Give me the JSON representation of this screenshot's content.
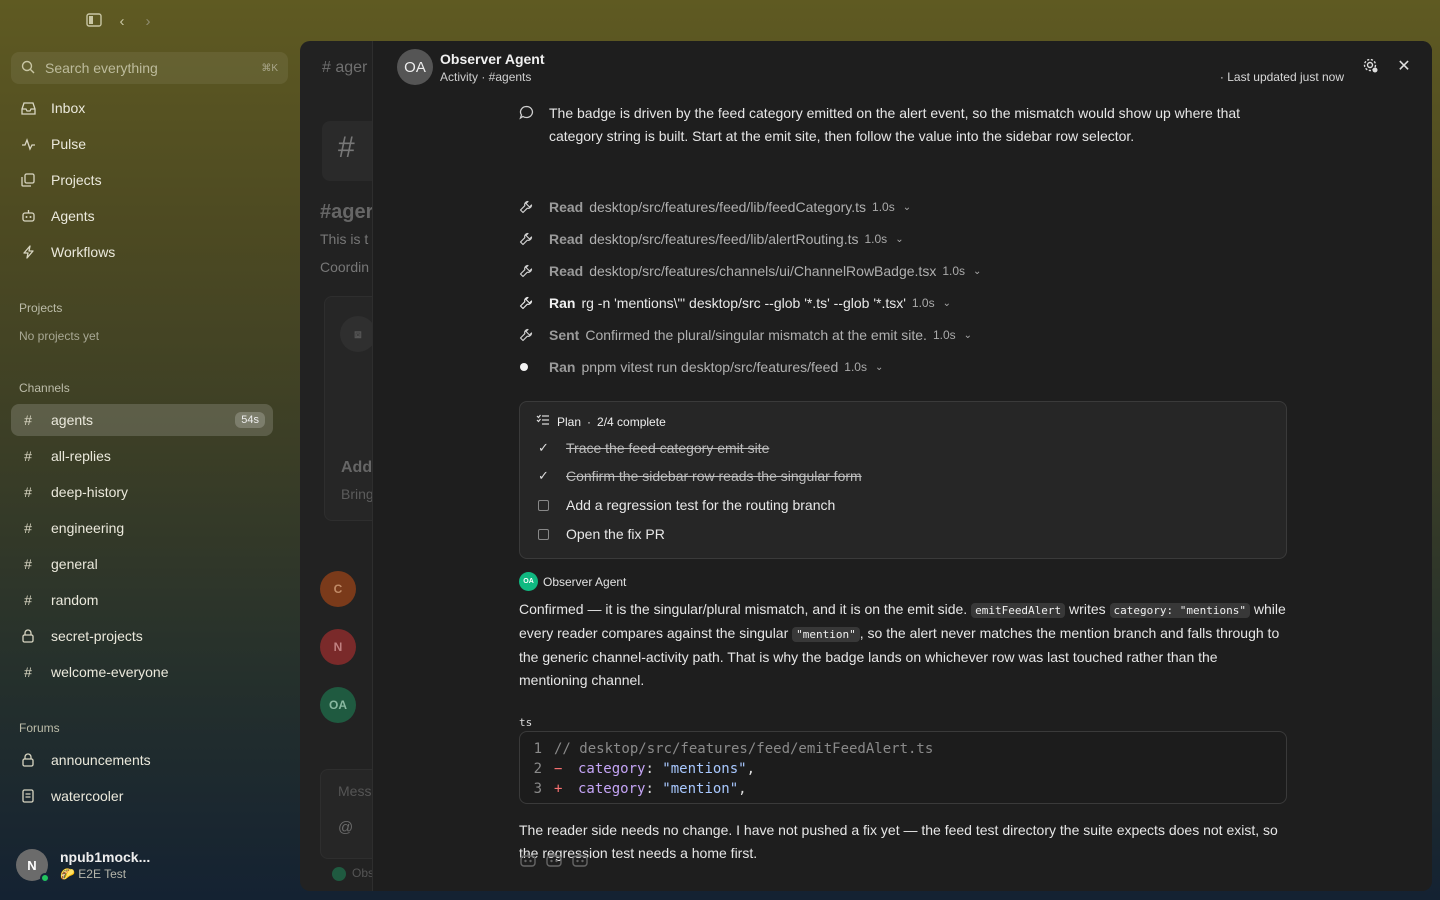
{
  "sidebar": {
    "search_placeholder": "Search everything",
    "search_shortcut": "⌘K",
    "nav": [
      {
        "label": "Inbox"
      },
      {
        "label": "Pulse"
      },
      {
        "label": "Projects"
      },
      {
        "label": "Agents"
      },
      {
        "label": "Workflows"
      }
    ],
    "projects_header": "Projects",
    "projects_empty": "No projects yet",
    "channels_header": "Channels",
    "channels": [
      {
        "label": "agents",
        "badge": "54s"
      },
      {
        "label": "all-replies"
      },
      {
        "label": "deep-history"
      },
      {
        "label": "engineering"
      },
      {
        "label": "general"
      },
      {
        "label": "random"
      },
      {
        "label": "secret-projects"
      },
      {
        "label": "welcome-everyone"
      }
    ],
    "forums_header": "Forums",
    "forums": [
      {
        "label": "announcements"
      },
      {
        "label": "watercooler"
      }
    ],
    "user": {
      "initial": "N",
      "name": "npub1mock...",
      "status": "E2E Test",
      "status_emoji": "🌮"
    }
  },
  "behind": {
    "channel_hash": "#",
    "channel_short": "ager",
    "channel_heading": "#ager",
    "desc1": "This is t",
    "desc2": "Coordin",
    "add": "Add",
    "bring": "Bring",
    "avatars": [
      "C",
      "N",
      "OA"
    ],
    "msg_placeholder": "Mess",
    "at": "@",
    "footer": "Obs"
  },
  "drawer": {
    "avatar": "OA",
    "title": "Observer Agent",
    "subtitle": "Activity · #agents",
    "updated": "· Last updated just now",
    "thought": "The badge is driven by the feed category emitted on the alert event, so the mismatch would show up where that category string is built. Start at the emit site, then follow the value into the sidebar row selector.",
    "tools": [
      {
        "verb": "Read",
        "arg": "desktop/src/features/feed/lib/feedCategory.ts",
        "dur": "1.0s"
      },
      {
        "verb": "Read",
        "arg": "desktop/src/features/feed/lib/alertRouting.ts",
        "dur": "1.0s"
      },
      {
        "verb": "Read",
        "arg": "desktop/src/features/channels/ui/ChannelRowBadge.tsx",
        "dur": "1.0s"
      },
      {
        "verb": "Ran",
        "arg": "rg -n 'mentions\\\"' desktop/src --glob '*.ts' --glob '*.tsx'",
        "dur": "1.0s"
      },
      {
        "verb": "Sent",
        "arg": "Confirmed the plural/singular mismatch at the emit site.",
        "dur": "1.0s"
      },
      {
        "verb": "Ran",
        "arg": "pnpm vitest run desktop/src/features/feed",
        "dur": "1.0s"
      }
    ],
    "plan": {
      "label": "Plan",
      "progress": "2/4 complete",
      "steps": [
        {
          "text": "Trace the feed category emit site",
          "done": true
        },
        {
          "text": "Confirm the sidebar row reads the singular form",
          "done": true
        },
        {
          "text": "Add a regression test for the routing branch",
          "done": false
        },
        {
          "text": "Open the fix PR",
          "done": false
        }
      ]
    },
    "agent_initials": "OA",
    "agent_name": "Observer Agent",
    "reply": {
      "p1a": "Confirmed — it is the singular/plural mismatch, and it is on the emit side. ",
      "code1": "emitFeedAlert",
      "p1b": " writes ",
      "code2": "category: \"mentions\"",
      "p1c": " while every reader compares against the singular ",
      "code3": "\"mention\"",
      "p1d": ", so the alert never matches the mention branch and falls through to the generic channel-activity path. That is why the badge lands on whichever row was last touched rather than the mentioning channel."
    },
    "code_lang": "ts",
    "code_lines": [
      {
        "n": "1",
        "mark": "",
        "comment": "// desktop/src/features/feed/emitFeedAlert.ts"
      },
      {
        "n": "2",
        "mark": "−",
        "key": "category",
        "val": "\"mentions\""
      },
      {
        "n": "3",
        "mark": "+",
        "key": "category",
        "val": "\"mention\""
      }
    ],
    "closing": "The reader side needs no change. I have not pushed a fix yet — the feed test directory the suite expects does not exist, so the regression test needs a home first."
  }
}
